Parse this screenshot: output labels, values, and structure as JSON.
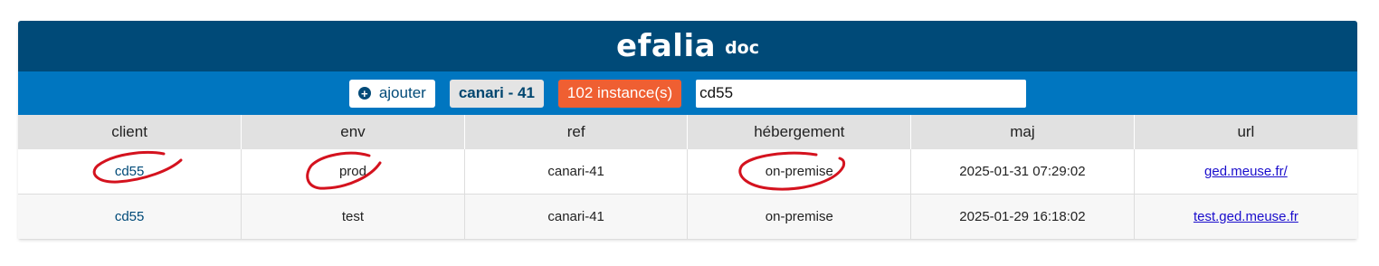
{
  "header": {
    "brand": "efalia",
    "brand_suffix": "doc"
  },
  "toolbar": {
    "add_label": "ajouter",
    "ref_label": "canari - 41",
    "count_label": "102 instance(s)",
    "search_value": "cd55"
  },
  "table": {
    "columns": [
      "client",
      "env",
      "ref",
      "hébergement",
      "maj",
      "url"
    ],
    "rows": [
      {
        "client": "cd55",
        "env": "prod",
        "ref": "canari-41",
        "hebergement": "on-premise",
        "maj": "2025-01-31 07:29:02",
        "url": "ged.meuse.fr/"
      },
      {
        "client": "cd55",
        "env": "test",
        "ref": "canari-41",
        "hebergement": "on-premise",
        "maj": "2025-01-29 16:18:02",
        "url": "test.ged.meuse.fr"
      }
    ]
  },
  "colors": {
    "brand_bar": "#004a78",
    "toolbar": "#0076c0",
    "count_badge": "#ef5f32",
    "annotation": "#d4121e"
  }
}
